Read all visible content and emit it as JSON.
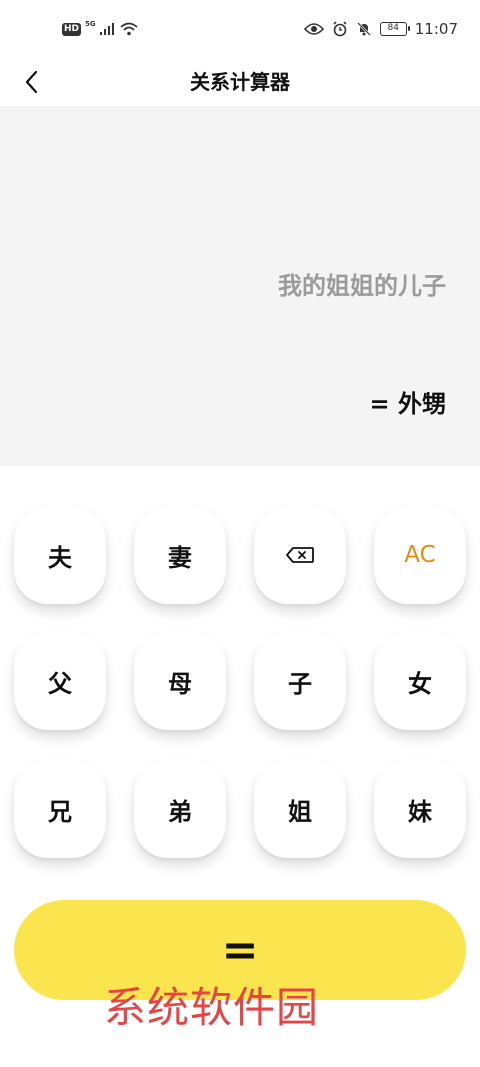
{
  "status_bar": {
    "hd": "HD",
    "network": "5G",
    "battery": "84",
    "time": "11:07"
  },
  "app_bar": {
    "title": "关系计算器"
  },
  "display": {
    "expression": "我的姐姐的儿子",
    "result": "= 外甥"
  },
  "keypad": {
    "row1": [
      "夫",
      "妻",
      "⌫",
      "AC"
    ],
    "row2": [
      "父",
      "母",
      "子",
      "女"
    ],
    "row3": [
      "兄",
      "弟",
      "姐",
      "妹"
    ]
  },
  "equals_label": "=",
  "watermark": "系统软件园",
  "colors": {
    "display_bg": "#f4f4f4",
    "equals_bg": "#fbe54f",
    "ac_text": "#e38a14",
    "watermark": "#e64545",
    "expression_text": "#9b9b9b"
  }
}
